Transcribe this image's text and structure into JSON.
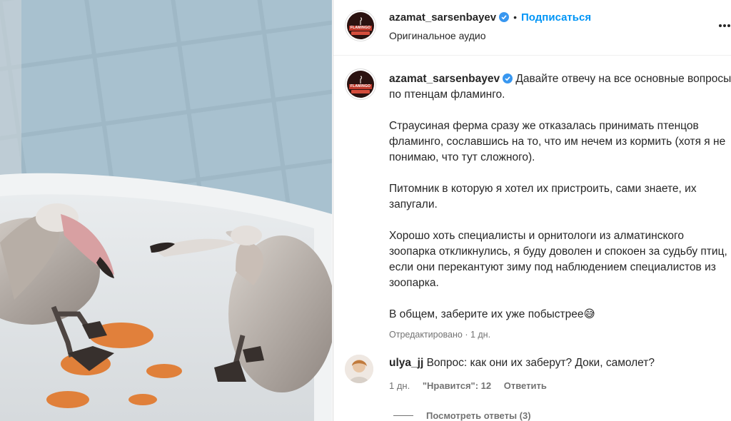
{
  "post": {
    "username": "azamat_sarsenbayev",
    "follow_label": "Подписаться",
    "separator": "•",
    "audio_label": "Оригинальное аудио",
    "avatar_logo_text": "FLAMINGO"
  },
  "caption": {
    "username": "azamat_sarsenbayev",
    "paragraphs": [
      "Давайте отвечу на все основные вопросы по птенцам фламинго.",
      "Страусиная ферма сразу же отказалась принимать птенцов фламинго, сославшись на то, что им нечем из кормить (хотя я не понимаю, что тут сложного).",
      "Питомник в которую я хотел их пристроить, сами знаете, их запугали.",
      "Хорошо хоть специалисты и орнитологи из алматинского зоопарка откликнулись, я буду доволен и спокоен за судьбу птиц, если они перекантуют зиму под наблюдением специалистов из зоопарка.",
      "В общем, заберите их уже побыстрее😅"
    ],
    "meta": "Отредактировано · 1 дн."
  },
  "comment": {
    "username": "ulya_jj",
    "text": "Вопрос: как они их заберут? Доки, самолет?",
    "time": "1 дн.",
    "likes": "\"Нравится\": 12",
    "reply_label": "Ответить",
    "view_replies": "Посмотреть ответы (3)"
  },
  "colors": {
    "accent": "#0095f6",
    "verified": "#3897f0",
    "muted": "#737373",
    "border": "#dbdbdb"
  },
  "icons": [
    "verified-badge-icon",
    "more-options-icon",
    "flamingo-logo-icon"
  ]
}
